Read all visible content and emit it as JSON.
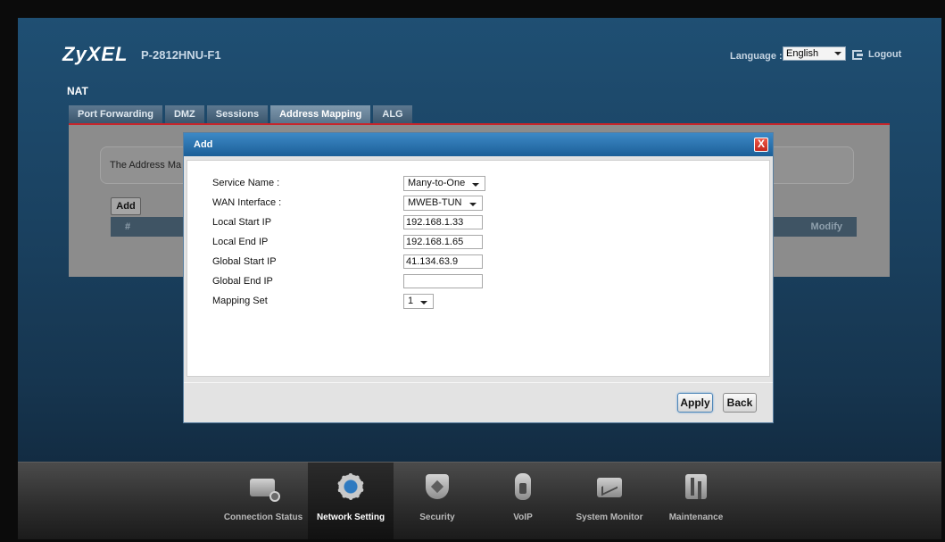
{
  "header": {
    "brand": "ZyXEL",
    "model": "P-2812HNU-F1",
    "language_label": "Language :",
    "language_value": "English",
    "logout_label": "Logout"
  },
  "page": {
    "title": "NAT",
    "tabs": [
      {
        "label": "Port Forwarding",
        "active": false
      },
      {
        "label": "DMZ",
        "active": false
      },
      {
        "label": "Sessions",
        "active": false
      },
      {
        "label": "Address Mapping",
        "active": true
      },
      {
        "label": "ALG",
        "active": false
      }
    ],
    "info_text": "The Address Ma",
    "add_label": "Add",
    "table_headers": {
      "index": "#",
      "modify": "Modify"
    }
  },
  "modal": {
    "title": "Add",
    "close_glyph": "X",
    "fields": {
      "service_name": {
        "label": "Service Name :",
        "value": "Many-to-One"
      },
      "wan_interface": {
        "label": "WAN Interface :",
        "value": "MWEB-TUN"
      },
      "local_start_ip": {
        "label": "Local Start IP",
        "value": "192.168.1.33"
      },
      "local_end_ip": {
        "label": "Local End IP",
        "value": "192.168.1.65"
      },
      "global_start_ip": {
        "label": "Global Start IP",
        "value": "41.134.63.9"
      },
      "global_end_ip": {
        "label": "Global End IP",
        "value": ""
      },
      "mapping_set": {
        "label": "Mapping Set",
        "value": "1"
      }
    },
    "apply_label": "Apply",
    "back_label": "Back"
  },
  "bottom_nav": [
    {
      "label": "Connection Status",
      "icon": "connection-status-icon",
      "active": false
    },
    {
      "label": "Network Setting",
      "icon": "gear-icon",
      "active": true
    },
    {
      "label": "Security",
      "icon": "shield-icon",
      "active": false
    },
    {
      "label": "VoIP",
      "icon": "phone-icon",
      "active": false
    },
    {
      "label": "System Monitor",
      "icon": "chart-icon",
      "active": false
    },
    {
      "label": "Maintenance",
      "icon": "tools-icon",
      "active": false
    }
  ],
  "colors": {
    "frame_blue": "#1a4160",
    "modal_header": "#1c5f98",
    "tab_accent": "#c8252a",
    "close_red": "#c4271b"
  }
}
